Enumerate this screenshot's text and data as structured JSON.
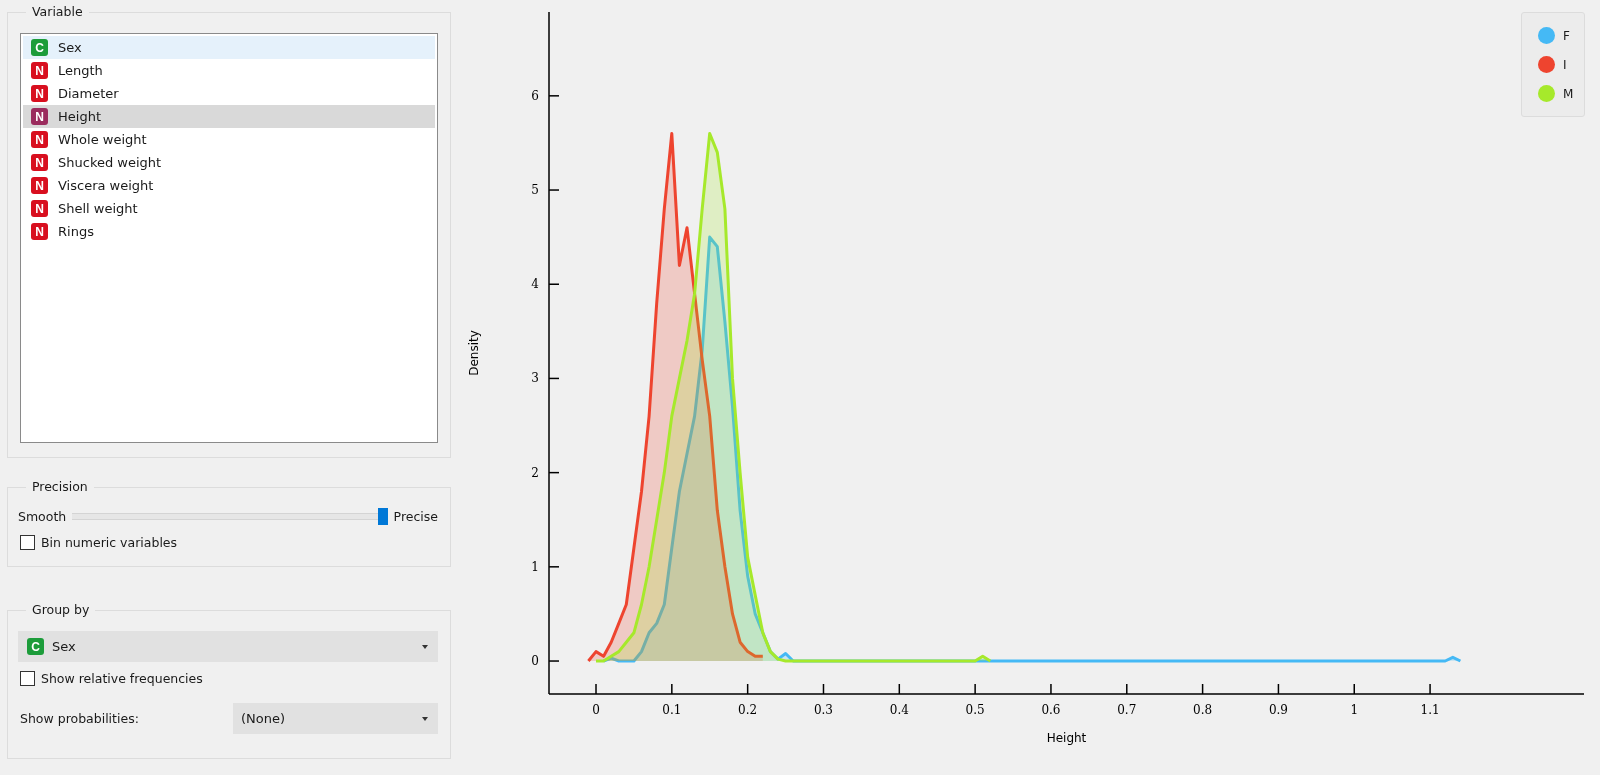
{
  "variable_box": {
    "title": "Variable",
    "items": [
      {
        "badge": "C",
        "kind": "categorical",
        "label": "Sex",
        "selected": false,
        "hovered": true
      },
      {
        "badge": "N",
        "kind": "numeric",
        "label": "Length",
        "selected": false,
        "hovered": false
      },
      {
        "badge": "N",
        "kind": "numeric",
        "label": "Diameter",
        "selected": false,
        "hovered": false
      },
      {
        "badge": "N",
        "kind": "numeric",
        "label": "Height",
        "selected": true,
        "hovered": false
      },
      {
        "badge": "N",
        "kind": "numeric",
        "label": "Whole weight",
        "selected": false,
        "hovered": false
      },
      {
        "badge": "N",
        "kind": "numeric",
        "label": "Shucked weight",
        "selected": false,
        "hovered": false
      },
      {
        "badge": "N",
        "kind": "numeric",
        "label": "Viscera weight",
        "selected": false,
        "hovered": false
      },
      {
        "badge": "N",
        "kind": "numeric",
        "label": "Shell weight",
        "selected": false,
        "hovered": false
      },
      {
        "badge": "N",
        "kind": "numeric",
        "label": "Rings",
        "selected": false,
        "hovered": false
      }
    ]
  },
  "precision_box": {
    "title": "Precision",
    "slider": {
      "left_label": "Smooth",
      "right_label": "Precise",
      "level": 1.0
    },
    "bin_numeric": {
      "label": "Bin numeric variables",
      "checked": false
    }
  },
  "group_box": {
    "title": "Group by",
    "group_select": {
      "badge": "C",
      "kind": "categorical",
      "value": "Sex"
    },
    "relative_frequencies": {
      "label": "Show relative frequencies",
      "checked": false
    },
    "probabilities": {
      "label": "Show probabilities:",
      "value": "(None)"
    }
  },
  "chart": {
    "chart_data": {
      "type": "area",
      "xlabel": "Height",
      "ylabel": "Density",
      "x": [
        -0.01,
        0,
        0.01,
        0.02,
        0.03,
        0.04,
        0.05,
        0.06,
        0.07,
        0.08,
        0.09,
        0.1,
        0.11,
        0.12,
        0.13,
        0.14,
        0.15,
        0.16,
        0.17,
        0.18,
        0.19,
        0.2,
        0.21,
        0.22,
        0.23,
        0.24,
        0.25,
        0.26,
        0.3,
        0.4,
        0.5,
        0.51,
        0.52,
        0.6,
        0.7,
        0.8,
        0.9,
        1.0,
        1.1,
        1.12,
        1.13,
        1.14
      ],
      "series": [
        {
          "name": "F",
          "color": "#45b9f5",
          "values": [
            null,
            null,
            0,
            0.03,
            0,
            0,
            0,
            0.1,
            0.3,
            0.4,
            0.6,
            1.2,
            1.8,
            2.2,
            2.6,
            3.3,
            4.5,
            4.4,
            3.6,
            2.7,
            1.6,
            0.9,
            0.5,
            0.3,
            0.1,
            0.02,
            0.08,
            0,
            0,
            0,
            0,
            0,
            0,
            0,
            0,
            0,
            0,
            0,
            0,
            0,
            0.04,
            0
          ]
        },
        {
          "name": "I",
          "color": "#ee442f",
          "values": [
            0,
            0.1,
            0.05,
            0.2,
            0.4,
            0.6,
            1.2,
            1.8,
            2.6,
            3.8,
            4.8,
            5.6,
            4.2,
            4.6,
            3.9,
            3.2,
            2.6,
            1.6,
            1.0,
            0.5,
            0.2,
            0.1,
            0.05,
            0.05,
            null,
            null,
            null,
            null,
            null,
            null,
            null,
            null,
            null,
            null,
            null,
            null,
            null,
            null,
            null,
            null,
            null,
            null
          ]
        },
        {
          "name": "M",
          "color": "#a6e92b",
          "values": [
            null,
            0,
            0,
            0.05,
            0.1,
            0.2,
            0.3,
            0.6,
            1.0,
            1.5,
            2.0,
            2.6,
            3.0,
            3.4,
            3.9,
            4.8,
            5.6,
            5.4,
            4.8,
            3.0,
            2.0,
            1.1,
            0.7,
            0.3,
            0.1,
            0.02,
            0,
            0,
            0,
            0,
            0,
            0.05,
            0,
            null,
            null,
            null,
            null,
            null,
            null,
            null,
            null,
            null
          ]
        }
      ],
      "xlim": [
        -0.062,
        1.303
      ],
      "ylim": [
        -0.35,
        6.89
      ],
      "xticks": [
        {
          "value": 0,
          "label": "0"
        },
        0.1,
        0.2,
        0.3,
        0.4,
        0.5,
        0.6,
        0.7,
        0.8,
        0.9,
        {
          "value": 1,
          "label": "1"
        },
        1.1
      ],
      "yticks": [
        0,
        1,
        2,
        3,
        4,
        5,
        6
      ]
    }
  }
}
